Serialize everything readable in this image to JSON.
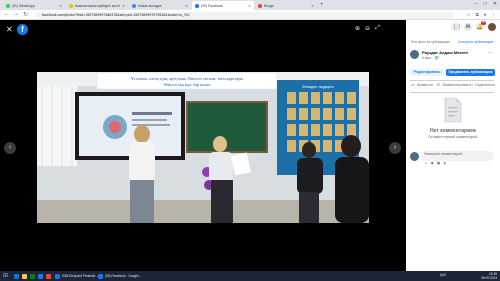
{
  "browser": {
    "tabs": [
      {
        "label": "(51) WhatsApp",
        "color": "#25d366"
      },
      {
        "label": "Компьютерлік жүйедегі мәтіннің...",
        "color": "#fbbc04"
      },
      {
        "label": "Новая вкладка",
        "color": "#4285f4"
      },
      {
        "label": "(39) Facebook",
        "color": "#1877f2",
        "active": true
      },
      {
        "label": "Входя",
        "color": "#ea4335"
      }
    ],
    "new_tab": "+",
    "url": "facebook.com/photo/?fbid=1557369997486378&set=pcb.1557369997079536&locale=ru_RU",
    "window_controls": [
      "–",
      "□",
      "✕"
    ]
  },
  "viewer": {
    "close": "✕",
    "logo": "f",
    "prev": "‹",
    "next": "›",
    "tools": [
      "⊕",
      "⊖",
      "⤢"
    ],
    "photo": {
      "banner_text": "Ұстазым, әлсең едің, әрттуына, Өнегелі тағзым, тағы қарттары",
      "banner_text2": "Өнегелі таң жұл, бар қалыс",
      "board_heading": "Әлемдегі таңдаулы"
    }
  },
  "panel": {
    "icons": [
      "⋮⋮",
      "✉",
      "🔔"
    ],
    "notif_count": "20",
    "privacy_line": "Это фото из публикации",
    "open_post": "Смотреть публикацию",
    "author": "Рауәдат Алдаш Мектеп",
    "time": "5 мин. · 🌐",
    "edit_btn": "Редактировать",
    "promote_btn": "Продвигать публикацию",
    "like": "Нравится",
    "comment": "Комментировать",
    "share": "Поделиться",
    "no_comments": "Нет комментариев",
    "be_first": "Оставьте первый комментарий.",
    "comment_placeholder": "Напишите комментарий..."
  },
  "taskbar": {
    "items": [
      {
        "label": "",
        "color": "#0078d4"
      },
      {
        "label": "",
        "color": "#f7c948"
      },
      {
        "label": "",
        "color": "#107c10"
      },
      {
        "label": "",
        "color": "#1877f2"
      },
      {
        "label": "",
        "color": "#ea4335"
      }
    ],
    "apps": [
      {
        "label": "ESB Endpoint Protectio...",
        "color": "#1a73e8"
      },
      {
        "label": "(39) Facebook - Google ...",
        "color": "#1877f2"
      }
    ],
    "lang": "ҚАЗ",
    "time": "16:38",
    "date": "06.09.2024"
  }
}
